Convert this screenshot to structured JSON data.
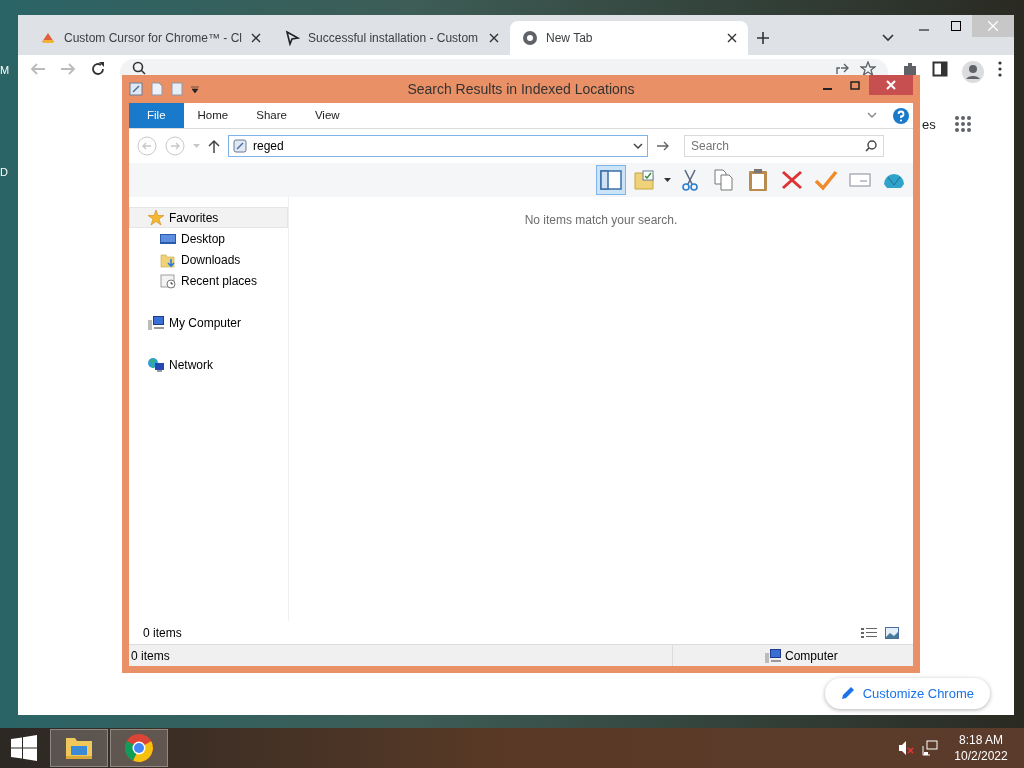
{
  "desktop": {
    "labels": [
      "M",
      "D"
    ]
  },
  "browser": {
    "tabs": [
      {
        "title": "Custom Cursor for Chrome™ - Cl",
        "selected": false
      },
      {
        "title": "Successful installation - Custom",
        "selected": false
      },
      {
        "title": "New Tab",
        "selected": true
      }
    ],
    "cut_text": "es",
    "customize_button": "Customize Chrome"
  },
  "explorer": {
    "title": "Search Results in Indexed Locations",
    "ribbon_tabs": [
      {
        "label": "File",
        "selected": true
      },
      {
        "label": "Home",
        "selected": false
      },
      {
        "label": "Share",
        "selected": false
      },
      {
        "label": "View",
        "selected": false
      }
    ],
    "address": {
      "value": "reged"
    },
    "search": {
      "placeholder": "Search"
    },
    "preview_pane_on": true,
    "nav": [
      {
        "label": "Favorites",
        "selected": true,
        "children": [
          {
            "label": "Desktop",
            "selected": false
          },
          {
            "label": "Downloads",
            "selected": false
          },
          {
            "label": "Recent places",
            "selected": false
          }
        ]
      },
      {
        "label": "My Computer",
        "selected": false
      },
      {
        "label": "Network",
        "selected": false
      }
    ],
    "message": "No items match your search.",
    "item_count": "0 items",
    "status": {
      "items": "0 items",
      "location": "Computer"
    }
  },
  "taskbar": {
    "time": "8:18 AM",
    "date": "10/2/2022"
  }
}
